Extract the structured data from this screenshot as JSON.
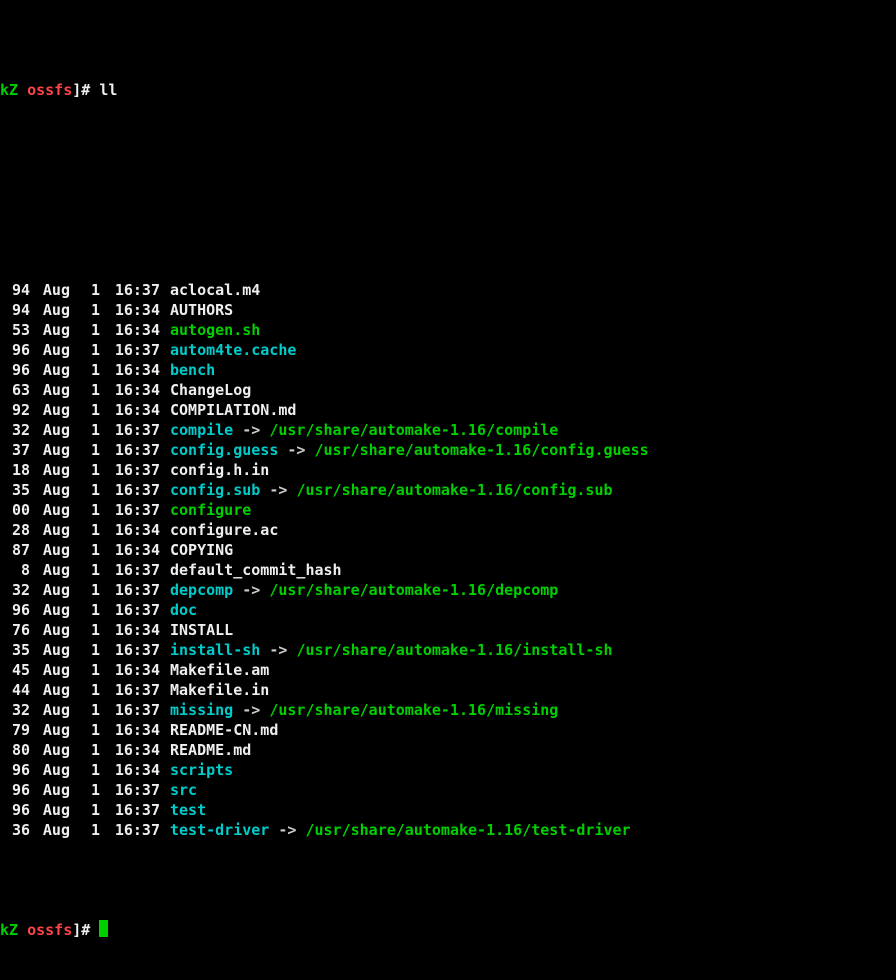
{
  "prompt": {
    "host_prefix": "kZ",
    "cwd": "ossfs",
    "bracket": "]",
    "marker": "#",
    "command": "ll"
  },
  "arrow": "->",
  "entries": [
    {
      "size": "94",
      "month": "Aug",
      "day": "1",
      "time": "16:37",
      "name": "aclocal.m4",
      "type": "file"
    },
    {
      "size": "94",
      "month": "Aug",
      "day": "1",
      "time": "16:34",
      "name": "AUTHORS",
      "type": "file"
    },
    {
      "size": "53",
      "month": "Aug",
      "day": "1",
      "time": "16:34",
      "name": "autogen.sh",
      "type": "exec"
    },
    {
      "size": "96",
      "month": "Aug",
      "day": "1",
      "time": "16:37",
      "name": "autom4te.cache",
      "type": "dir"
    },
    {
      "size": "96",
      "month": "Aug",
      "day": "1",
      "time": "16:34",
      "name": "bench",
      "type": "dir"
    },
    {
      "size": "63",
      "month": "Aug",
      "day": "1",
      "time": "16:34",
      "name": "ChangeLog",
      "type": "file"
    },
    {
      "size": "92",
      "month": "Aug",
      "day": "1",
      "time": "16:34",
      "name": "COMPILATION.md",
      "type": "file"
    },
    {
      "size": "32",
      "month": "Aug",
      "day": "1",
      "time": "16:37",
      "name": "compile",
      "type": "link",
      "target": "/usr/share/automake-1.16/compile"
    },
    {
      "size": "37",
      "month": "Aug",
      "day": "1",
      "time": "16:37",
      "name": "config.guess",
      "type": "link",
      "target": "/usr/share/automake-1.16/config.guess"
    },
    {
      "size": "18",
      "month": "Aug",
      "day": "1",
      "time": "16:37",
      "name": "config.h.in",
      "type": "file"
    },
    {
      "size": "35",
      "month": "Aug",
      "day": "1",
      "time": "16:37",
      "name": "config.sub",
      "type": "link",
      "target": "/usr/share/automake-1.16/config.sub"
    },
    {
      "size": "00",
      "month": "Aug",
      "day": "1",
      "time": "16:37",
      "name": "configure",
      "type": "exec"
    },
    {
      "size": "28",
      "month": "Aug",
      "day": "1",
      "time": "16:34",
      "name": "configure.ac",
      "type": "file"
    },
    {
      "size": "87",
      "month": "Aug",
      "day": "1",
      "time": "16:34",
      "name": "COPYING",
      "type": "file"
    },
    {
      "size": "8",
      "month": "Aug",
      "day": "1",
      "time": "16:37",
      "name": "default_commit_hash",
      "type": "file"
    },
    {
      "size": "32",
      "month": "Aug",
      "day": "1",
      "time": "16:37",
      "name": "depcomp",
      "type": "link",
      "target": "/usr/share/automake-1.16/depcomp"
    },
    {
      "size": "96",
      "month": "Aug",
      "day": "1",
      "time": "16:37",
      "name": "doc",
      "type": "dir"
    },
    {
      "size": "76",
      "month": "Aug",
      "day": "1",
      "time": "16:34",
      "name": "INSTALL",
      "type": "file"
    },
    {
      "size": "35",
      "month": "Aug",
      "day": "1",
      "time": "16:37",
      "name": "install-sh",
      "type": "link",
      "target": "/usr/share/automake-1.16/install-sh"
    },
    {
      "size": "45",
      "month": "Aug",
      "day": "1",
      "time": "16:34",
      "name": "Makefile.am",
      "type": "file"
    },
    {
      "size": "44",
      "month": "Aug",
      "day": "1",
      "time": "16:37",
      "name": "Makefile.in",
      "type": "file"
    },
    {
      "size": "32",
      "month": "Aug",
      "day": "1",
      "time": "16:37",
      "name": "missing",
      "type": "link",
      "target": "/usr/share/automake-1.16/missing"
    },
    {
      "size": "79",
      "month": "Aug",
      "day": "1",
      "time": "16:34",
      "name": "README-CN.md",
      "type": "file"
    },
    {
      "size": "80",
      "month": "Aug",
      "day": "1",
      "time": "16:34",
      "name": "README.md",
      "type": "file"
    },
    {
      "size": "96",
      "month": "Aug",
      "day": "1",
      "time": "16:34",
      "name": "scripts",
      "type": "dir"
    },
    {
      "size": "96",
      "month": "Aug",
      "day": "1",
      "time": "16:37",
      "name": "src",
      "type": "dir"
    },
    {
      "size": "96",
      "month": "Aug",
      "day": "1",
      "time": "16:37",
      "name": "test",
      "type": "dir"
    },
    {
      "size": "36",
      "month": "Aug",
      "day": "1",
      "time": "16:37",
      "name": "test-driver",
      "type": "link",
      "target": "/usr/share/automake-1.16/test-driver"
    }
  ]
}
